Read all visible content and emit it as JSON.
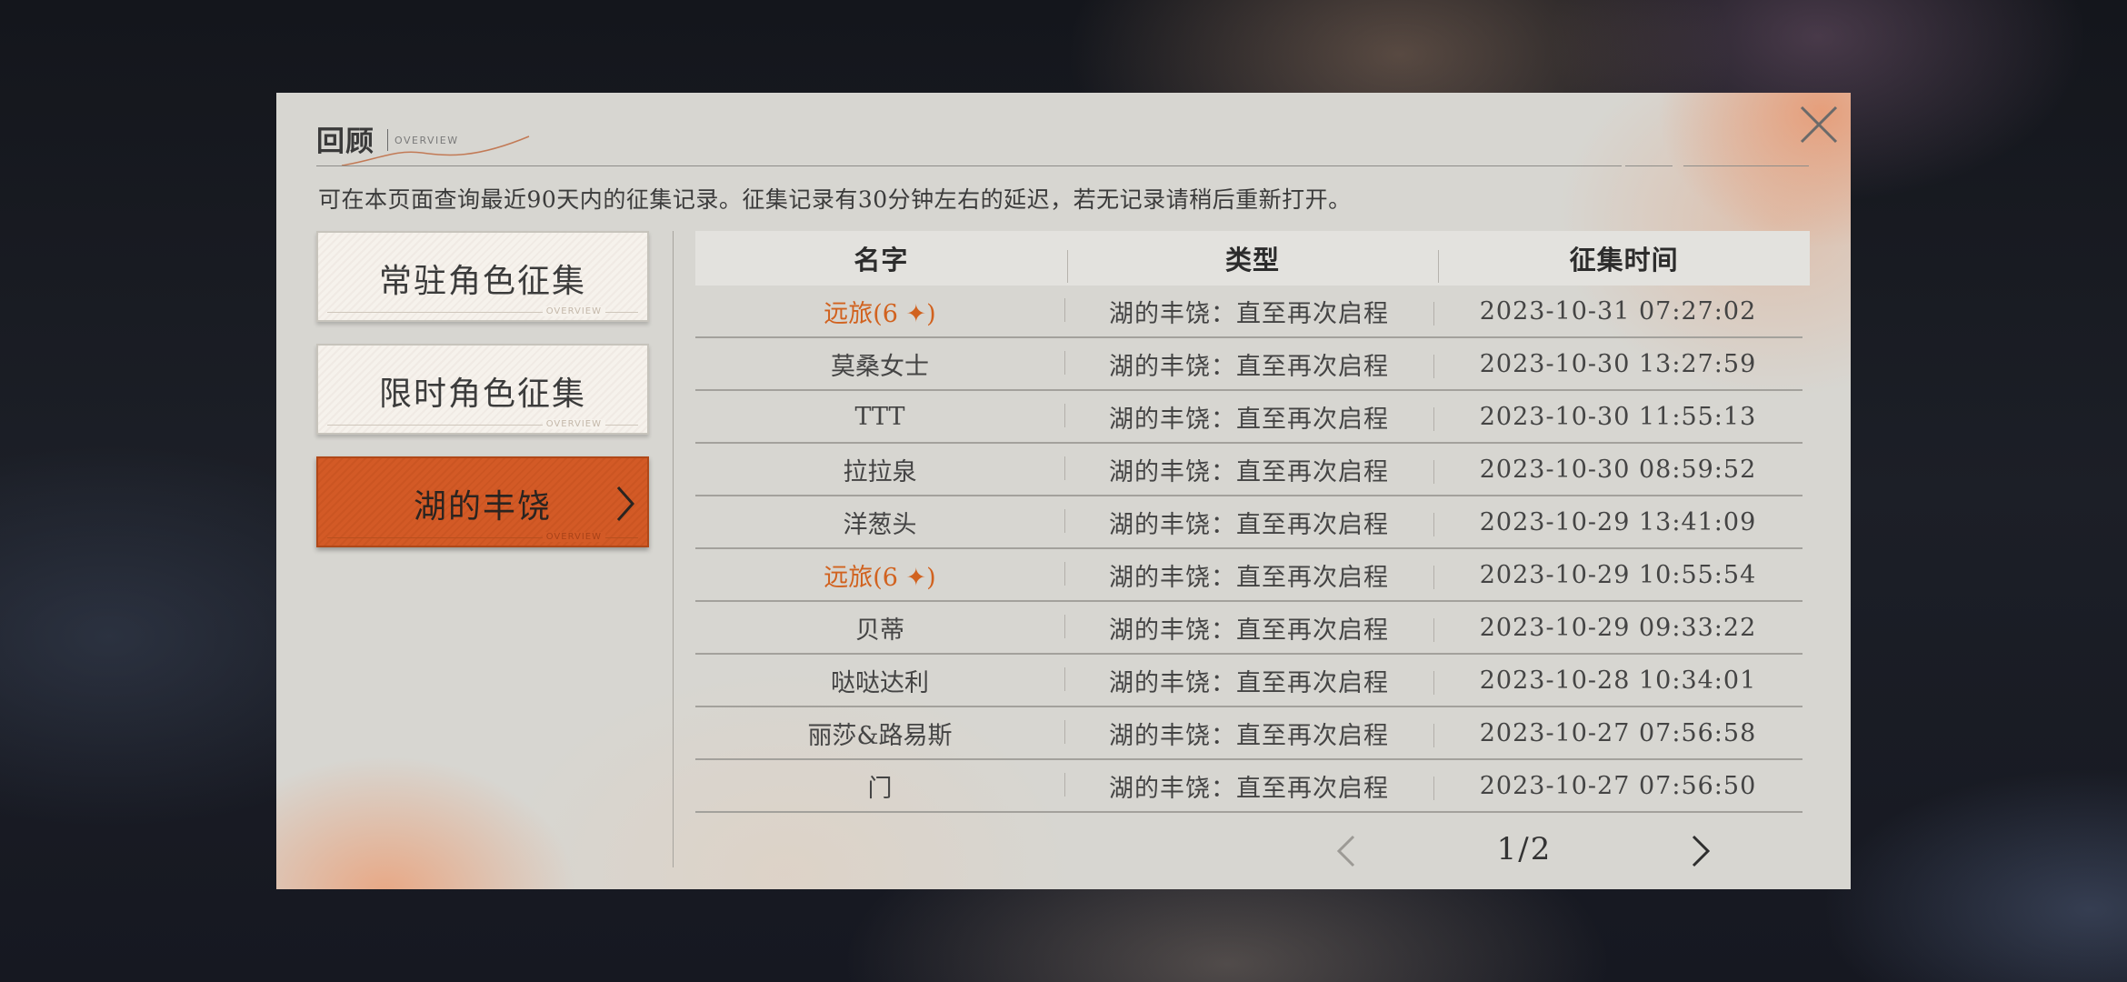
{
  "dialog": {
    "title": "回顾",
    "subtitle": "OVERVIEW",
    "notice": "可在本页面查询最近90天内的征集记录。征集记录有30分钟左右的延迟，若无记录请稍后重新打开。",
    "close_icon": "close-icon"
  },
  "sidebar": {
    "items": [
      {
        "label": "常驻角色征集",
        "tag": "OVERVIEW",
        "active": false
      },
      {
        "label": "限时角色征集",
        "tag": "OVERVIEW",
        "active": false
      },
      {
        "label": "湖的丰饶",
        "tag": "OVERVIEW",
        "active": true
      }
    ]
  },
  "table": {
    "headers": [
      "名字",
      "类型",
      "征集时间"
    ],
    "rows": [
      {
        "name": "远旅(6 ✦)",
        "type": "湖的丰饶：直至再次启程",
        "time": "2023-10-31 07:27:02",
        "rare": true
      },
      {
        "name": "莫桑女士",
        "type": "湖的丰饶：直至再次启程",
        "time": "2023-10-30 13:27:59",
        "rare": false
      },
      {
        "name": "TTT",
        "type": "湖的丰饶：直至再次启程",
        "time": "2023-10-30 11:55:13",
        "rare": false
      },
      {
        "name": "拉拉泉",
        "type": "湖的丰饶：直至再次启程",
        "time": "2023-10-30 08:59:52",
        "rare": false
      },
      {
        "name": "洋葱头",
        "type": "湖的丰饶：直至再次启程",
        "time": "2023-10-29 13:41:09",
        "rare": false
      },
      {
        "name": "远旅(6 ✦)",
        "type": "湖的丰饶：直至再次启程",
        "time": "2023-10-29 10:55:54",
        "rare": true
      },
      {
        "name": "贝蒂",
        "type": "湖的丰饶：直至再次启程",
        "time": "2023-10-29 09:33:22",
        "rare": false
      },
      {
        "name": "哒哒达利",
        "type": "湖的丰饶：直至再次启程",
        "time": "2023-10-28 10:34:01",
        "rare": false
      },
      {
        "name": "丽莎&路易斯",
        "type": "湖的丰饶：直至再次启程",
        "time": "2023-10-27 07:56:58",
        "rare": false
      },
      {
        "name": "门",
        "type": "湖的丰饶：直至再次启程",
        "time": "2023-10-27 07:56:50",
        "rare": false
      }
    ]
  },
  "pager": {
    "page_text": "1/2",
    "prev_icon": "chevron-left-icon",
    "next_icon": "chevron-right-icon",
    "prev_enabled": false,
    "next_enabled": true
  },
  "colors": {
    "accent": "#d35a26",
    "rare_text": "#d1621f",
    "panel_bg": "#d7d6d1"
  }
}
